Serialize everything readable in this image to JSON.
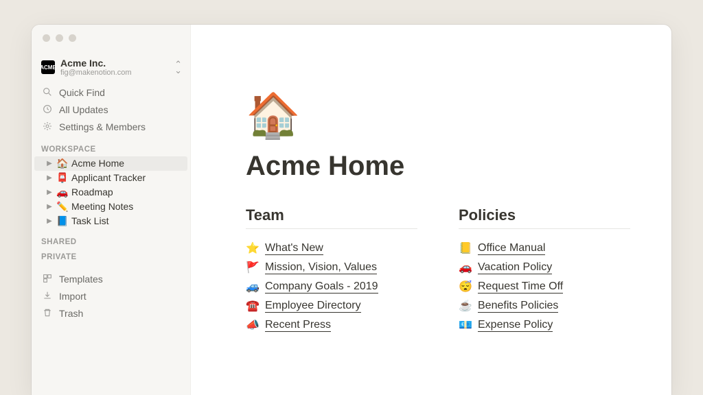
{
  "workspace": {
    "icon_text": "ACME",
    "name": "Acme Inc.",
    "email": "fig@makenotion.com"
  },
  "nav": {
    "quick_find": "Quick Find",
    "all_updates": "All Updates",
    "settings": "Settings & Members"
  },
  "sections": {
    "workspace_label": "Workspace",
    "shared_label": "Shared",
    "private_label": "Private"
  },
  "pages": [
    {
      "emoji": "🏠",
      "label": "Acme Home",
      "active": true
    },
    {
      "emoji": "📮",
      "label": "Applicant Tracker",
      "active": false
    },
    {
      "emoji": "🚗",
      "label": "Roadmap",
      "active": false
    },
    {
      "emoji": "✏️",
      "label": "Meeting Notes",
      "active": false
    },
    {
      "emoji": "📘",
      "label": "Task List",
      "active": false
    }
  ],
  "bottom": {
    "templates": "Templates",
    "import": "Import",
    "trash": "Trash"
  },
  "page": {
    "icon": "🏠",
    "title": "Acme Home",
    "columns": [
      {
        "heading": "Team",
        "links": [
          {
            "emoji": "⭐",
            "label": "What's New"
          },
          {
            "emoji": "🚩",
            "label": "Mission, Vision, Values"
          },
          {
            "emoji": "🚙",
            "label": "Company Goals - 2019"
          },
          {
            "emoji": "☎️",
            "label": "Employee Directory"
          },
          {
            "emoji": "📣",
            "label": "Recent Press"
          }
        ]
      },
      {
        "heading": "Policies",
        "links": [
          {
            "emoji": "📒",
            "label": "Office Manual"
          },
          {
            "emoji": "🚗",
            "label": "Vacation Policy"
          },
          {
            "emoji": "😴",
            "label": "Request Time Off"
          },
          {
            "emoji": "☕",
            "label": "Benefits Policies"
          },
          {
            "emoji": "💶",
            "label": "Expense Policy"
          }
        ]
      }
    ]
  }
}
